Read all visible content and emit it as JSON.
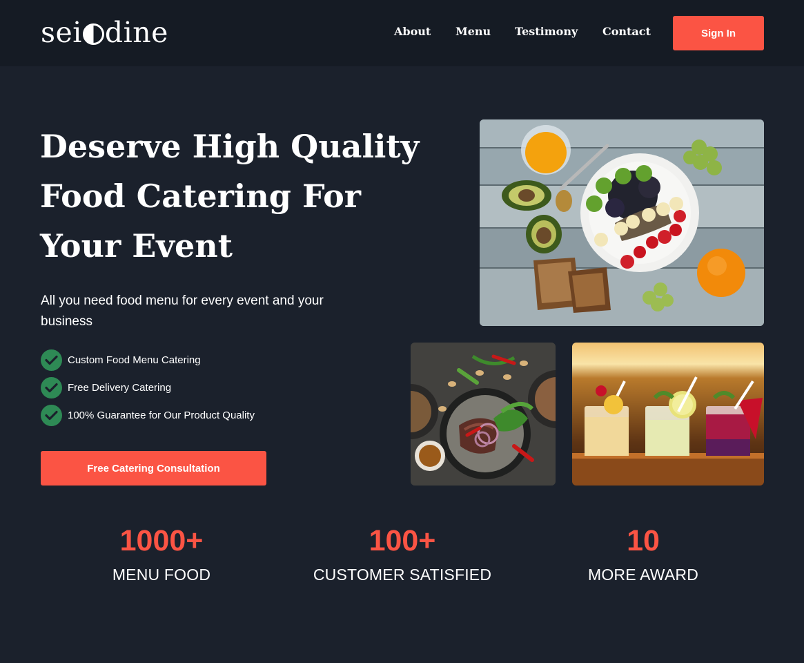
{
  "brand": {
    "logo_left": "sei",
    "logo_right": "dine"
  },
  "nav": {
    "items": [
      "About",
      "Menu",
      "Testimony",
      "Contact"
    ],
    "signin_label": "Sign In"
  },
  "hero": {
    "headline_lines": [
      "Deserve High Quality",
      "Food Catering For",
      "Your Event"
    ],
    "subline": "All you need food menu for every event and your business",
    "features": [
      "Custom Food Menu Catering",
      "Free Delivery Catering",
      "100% Guarantee for Our Product Quality"
    ],
    "cta_label": "Free Catering Consultation"
  },
  "stats": [
    {
      "value": "1000+",
      "label": "MENU FOOD"
    },
    {
      "value": "100+",
      "label": "CUSTOMER SATISFIED"
    },
    {
      "value": "10",
      "label": "MORE AWARD"
    }
  ],
  "colors": {
    "background": "#1b212c",
    "topbar": "#151b24",
    "accent": "#fb5444",
    "check": "#2e8a55"
  },
  "icons": [
    "check-icon"
  ]
}
